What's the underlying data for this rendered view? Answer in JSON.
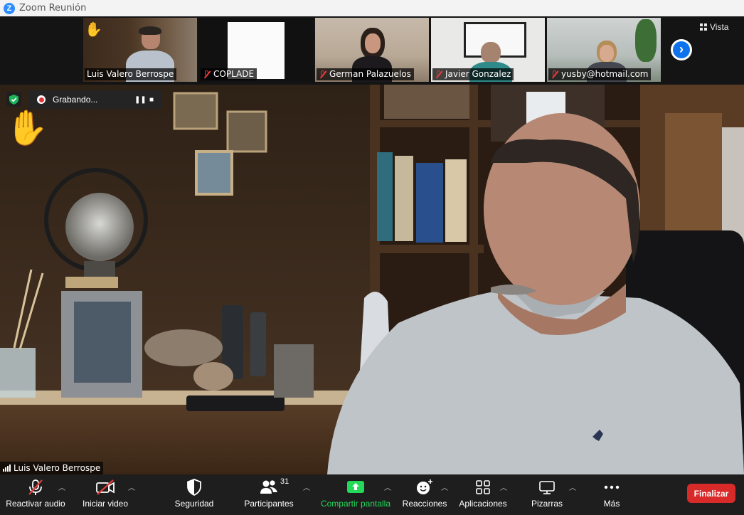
{
  "window": {
    "title": "Zoom Reunión"
  },
  "thumbnails": [
    {
      "name": "Luis Valero Berrospe",
      "muted": false,
      "active": true
    },
    {
      "name": "COPLADE",
      "muted": true,
      "active": false
    },
    {
      "name": "German Palazuelos",
      "muted": true,
      "active": false
    },
    {
      "name": "Javier Gonzalez",
      "muted": true,
      "active": false
    },
    {
      "name": "yusby@hotmail.com",
      "muted": true,
      "active": false
    }
  ],
  "view_button": {
    "label": "Vista"
  },
  "recording": {
    "label": "Grabando..."
  },
  "speaker": {
    "name": "Luis Valero Berrospe"
  },
  "toolbar": {
    "audio_label": "Reactivar audio",
    "video_label": "Iniciar video",
    "security_label": "Seguridad",
    "participants_label": "Participantes",
    "participants_count": "31",
    "share_label": "Compartir pantalla",
    "reactions_label": "Reacciones",
    "apps_label": "Aplicaciones",
    "whiteboards_label": "Pizarras",
    "more_label": "Más",
    "end_label": "Finalizar"
  },
  "colors": {
    "share_green": "#23d959",
    "end_red": "#d92a2a",
    "active_border": "#7bd14b",
    "accent_blue": "#0e72ed"
  }
}
